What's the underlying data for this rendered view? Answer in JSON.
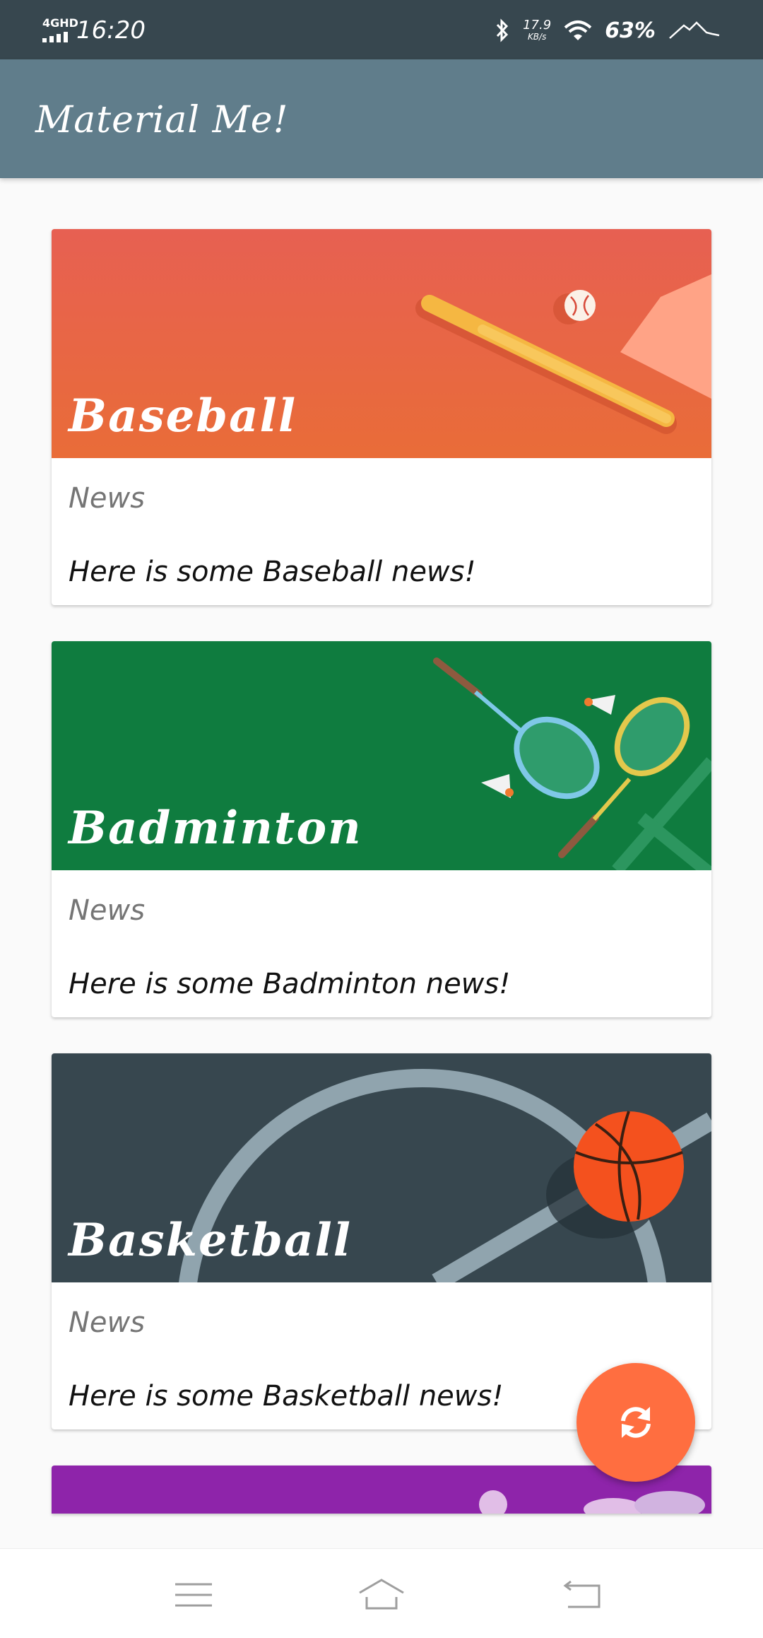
{
  "status_bar": {
    "network": "4GHD",
    "time": "16:20",
    "speed_value": "17.9",
    "speed_unit": "KB/s",
    "battery": "63%",
    "icons": [
      "signal-icon",
      "bluetooth-icon",
      "wifi-icon",
      "battery-icon"
    ]
  },
  "app_bar": {
    "title": "Material Me!",
    "color": "#607d8b"
  },
  "cards": [
    {
      "title": "Baseball",
      "subtitle": "News",
      "body": "Here is some Baseball news!",
      "color": "#e86a45"
    },
    {
      "title": "Badminton",
      "subtitle": "News",
      "body": "Here is some Badminton news!",
      "color": "#0f7c3f"
    },
    {
      "title": "Basketball",
      "subtitle": "News",
      "body": "Here is some Basketball news!",
      "color": "#37474f"
    },
    {
      "color": "#8e24aa"
    }
  ],
  "fab": {
    "icon": "refresh-icon",
    "color": "#ff6e40"
  },
  "nav_bar": {
    "icons": [
      "menu-icon",
      "home-icon",
      "back-icon"
    ]
  }
}
